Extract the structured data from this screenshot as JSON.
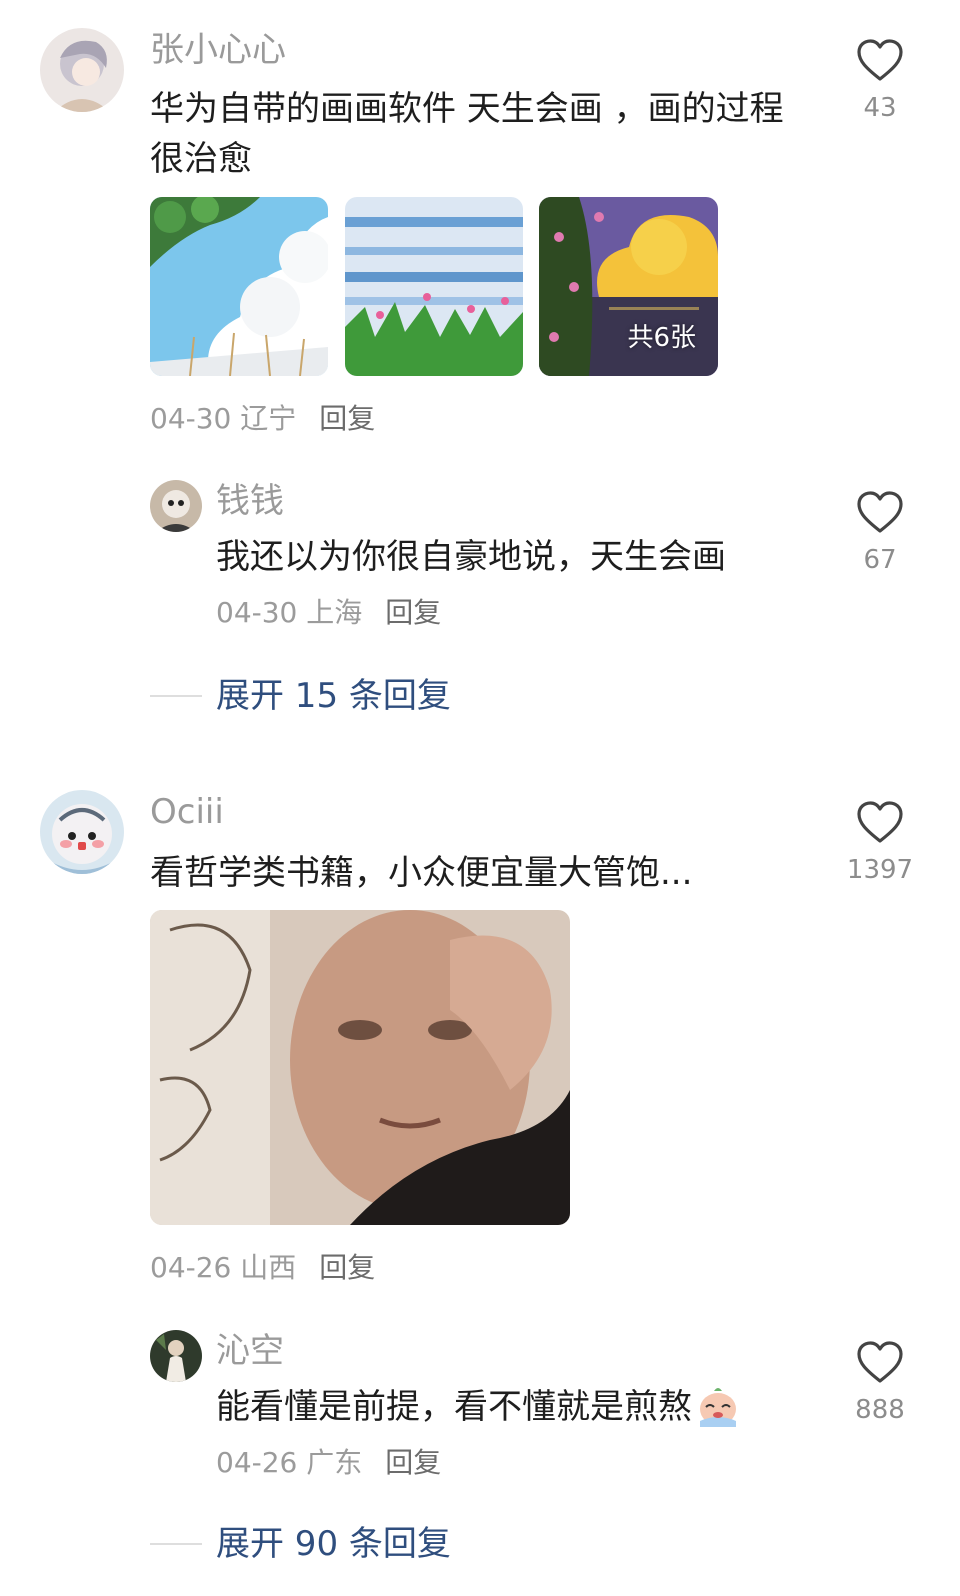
{
  "comments": [
    {
      "username": "张小心心",
      "text": "华为自带的画画软件 天生会画 ，画的过程很治愈",
      "images_count_badge": "共6张",
      "date": "04-30",
      "location": "辽宁",
      "reply_label": "回复",
      "likes": "43",
      "replies": [
        {
          "username": "钱钱",
          "text": "我还以为你很自豪地说，天生会画",
          "date": "04-30",
          "location": "上海",
          "reply_label": "回复",
          "likes": "67"
        }
      ],
      "expand_label": "展开 15 条回复"
    },
    {
      "username": "Ociii",
      "text": "看哲学类书籍，小众便宜量大管饱...",
      "date": "04-26",
      "location": "山西",
      "reply_label": "回复",
      "likes": "1397",
      "replies": [
        {
          "username": "沁空",
          "text": "能看懂是前提，看不懂就是煎熬",
          "emoji": "crying-face-emoji",
          "date": "04-26",
          "location": "广东",
          "reply_label": "回复",
          "likes": "888"
        }
      ],
      "expand_label": "展开 90 条回复"
    }
  ],
  "icons": {
    "like": "heart-outline-icon"
  },
  "colors": {
    "username": "#9a9a9a",
    "text": "#1e1e1e",
    "expand_link": "#2f4e7e",
    "meta": "#9b9b9b"
  }
}
